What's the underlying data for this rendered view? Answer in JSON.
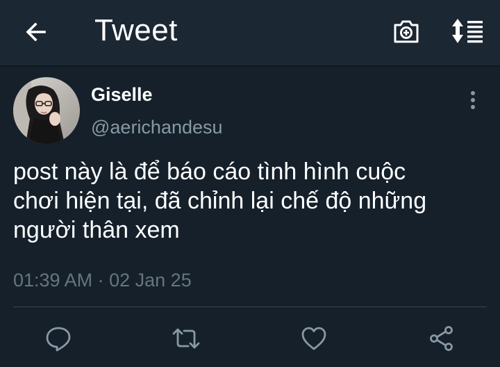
{
  "header": {
    "title": "Tweet",
    "back_icon": "arrow-left-icon",
    "camera_icon": "camera-plus-icon",
    "sort_icon": "sort-list-icon"
  },
  "tweet": {
    "author": {
      "display_name": "Giselle",
      "handle": "@aerichandesu"
    },
    "text_lines": [
      "post này là để báo cáo tình hình cuộc",
      "chơi hiện tại, đã chỉnh lại chế độ những",
      "người thân xem"
    ],
    "time": "01:39 AM",
    "separator": "·",
    "date": "02 Jan 25"
  },
  "actions": {
    "reply_icon": "reply-icon",
    "retweet_icon": "retweet-icon",
    "like_icon": "heart-icon",
    "share_icon": "share-icon"
  },
  "colors": {
    "background": "#15202b",
    "header_background": "#1b2733",
    "primary_text": "#ffffff",
    "secondary_text": "#8899a6",
    "meta_text": "#66757f",
    "divider": "#38444d",
    "icon": "#8899a6"
  }
}
